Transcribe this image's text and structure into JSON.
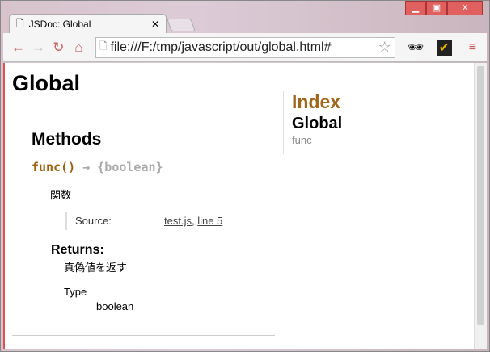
{
  "browser": {
    "tab_title": "JSDoc: Global",
    "url": "file:///F:/tmp/javascript/out/global.html#"
  },
  "page": {
    "title": "Global",
    "section": "Methods",
    "method_name": "func()",
    "arrow": "→",
    "return_sig": "{boolean}",
    "description": "関数",
    "source_label": "Source:",
    "source_file": "test.js",
    "source_line": "line 5",
    "returns_label": "Returns:",
    "returns_desc": "真偽値を返す",
    "type_label": "Type",
    "type_value": "boolean"
  },
  "nav": {
    "index": "Index",
    "global": "Global",
    "link": "func"
  }
}
